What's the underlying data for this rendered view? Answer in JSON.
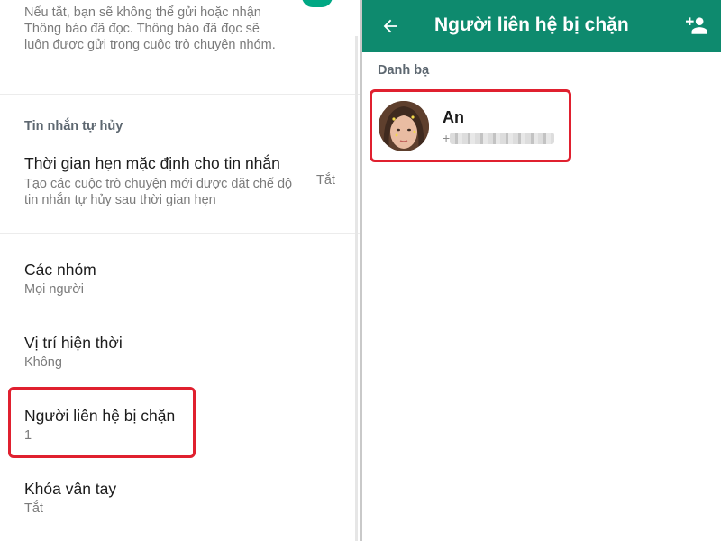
{
  "left": {
    "read_receipts_desc": "Nếu tắt, bạn sẽ không thể gửi hoặc nhận Thông báo đã đọc. Thông báo đã đọc sẽ luôn được gửi trong cuộc trò chuyện nhóm.",
    "section_disappearing": "Tin nhắn tự hủy",
    "disappearing": {
      "title": "Thời gian hẹn mặc định cho tin nhắn",
      "description": "Tạo các cuộc trò chuyện mới được đặt chế độ tin nhắn tự hủy sau thời gian hẹn",
      "value": "Tắt"
    },
    "groups": {
      "title": "Các nhóm",
      "value": "Mọi người"
    },
    "live_location": {
      "title": "Vị trí hiện thời",
      "value": "Không"
    },
    "blocked": {
      "title": "Người liên hệ bị chặn",
      "value": "1"
    },
    "fingerprint": {
      "title": "Khóa vân tay",
      "value": "Tắt"
    }
  },
  "right": {
    "title": "Người liên hệ bị chặn",
    "back_icon": "arrow-left-icon",
    "add_icon": "add-person-icon",
    "section_contacts": "Danh bạ",
    "contact": {
      "name": "An",
      "phone_prefix": "+"
    }
  },
  "colors": {
    "app_bar": "#0e8a6e",
    "highlight": "#e0202f",
    "toggle": "#00a884"
  }
}
